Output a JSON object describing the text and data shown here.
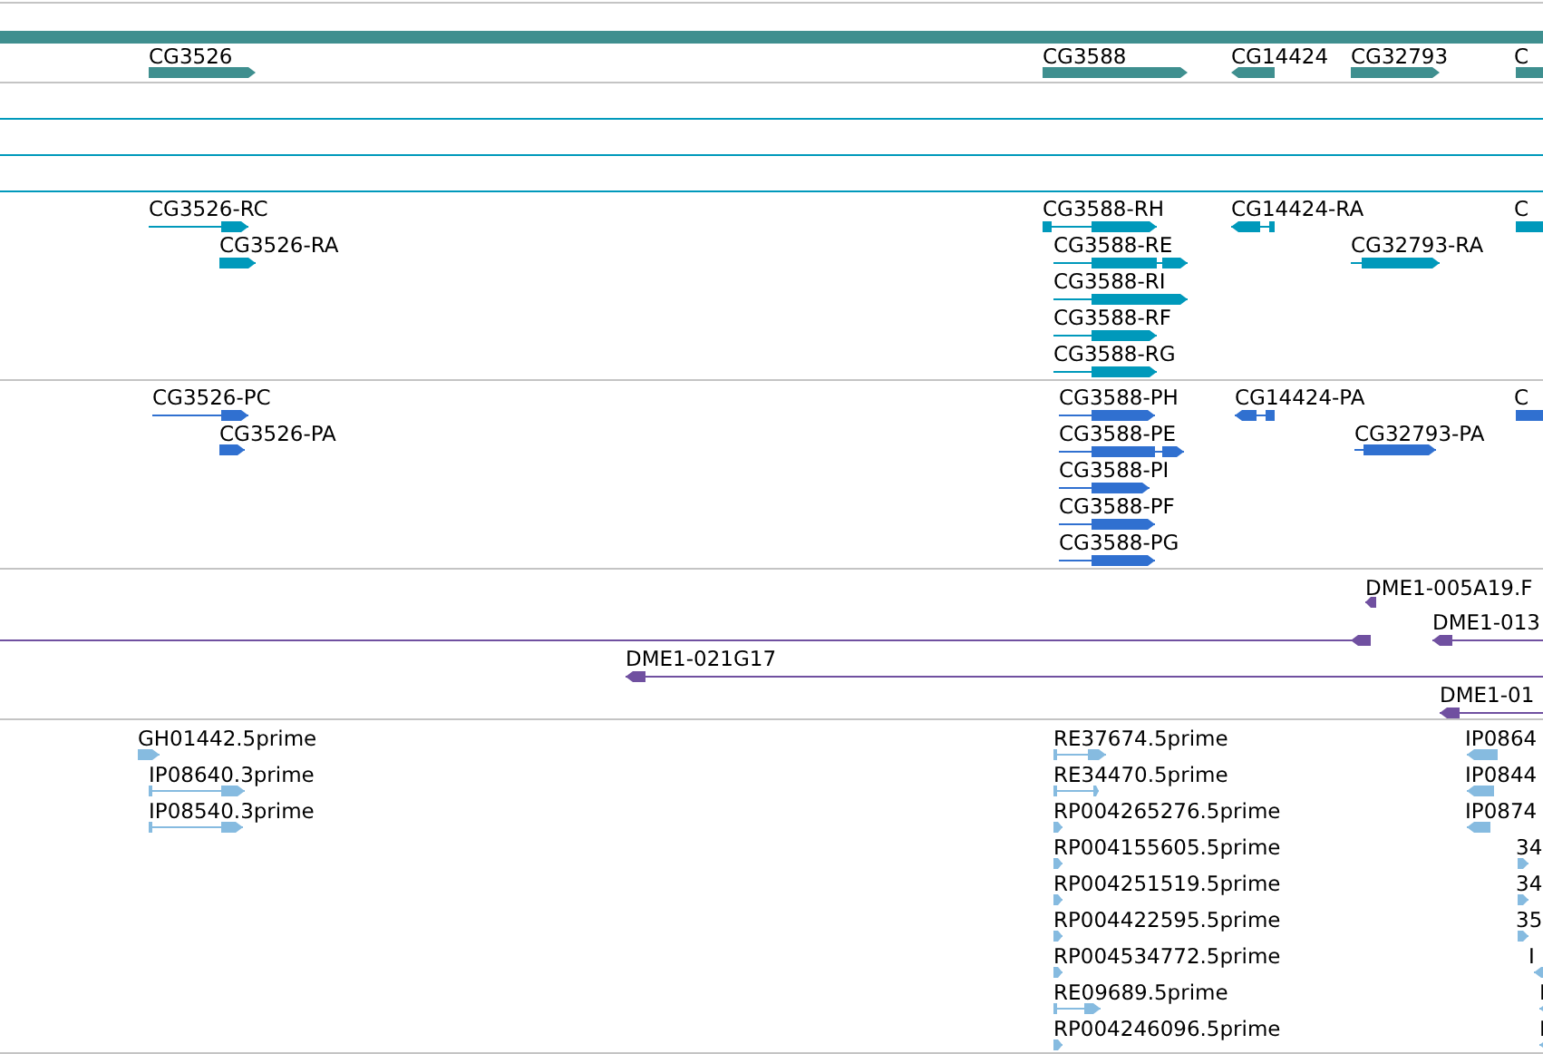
{
  "tracks": [
    {
      "kind": "gene",
      "features": [
        {
          "label": "CG3526",
          "reverse": false
        },
        {
          "label": "CG3588",
          "reverse": false
        },
        {
          "label": "CG14424",
          "reverse": true
        },
        {
          "label": "CG32793",
          "reverse": false
        },
        {
          "label": "C",
          "reverse": false
        }
      ]
    },
    {
      "kind": "transcript",
      "features": [
        {
          "label": "CG3526-RC",
          "reverse": false
        },
        {
          "label": "CG3526-RA",
          "reverse": false
        },
        {
          "label": "CG3588-RH",
          "reverse": false
        },
        {
          "label": "CG3588-RE",
          "reverse": false
        },
        {
          "label": "CG3588-RI",
          "reverse": false
        },
        {
          "label": "CG3588-RF",
          "reverse": false
        },
        {
          "label": "CG3588-RG",
          "reverse": false
        },
        {
          "label": "CG14424-RA",
          "reverse": true
        },
        {
          "label": "CG32793-RA",
          "reverse": false
        },
        {
          "label": "C",
          "reverse": false
        }
      ]
    },
    {
      "kind": "protein",
      "features": [
        {
          "label": "CG3526-PC",
          "reverse": false
        },
        {
          "label": "CG3526-PA",
          "reverse": false
        },
        {
          "label": "CG3588-PH",
          "reverse": false
        },
        {
          "label": "CG3588-PE",
          "reverse": false
        },
        {
          "label": "CG3588-PI",
          "reverse": false
        },
        {
          "label": "CG3588-PF",
          "reverse": false
        },
        {
          "label": "CG3588-PG",
          "reverse": false
        },
        {
          "label": "CG14424-PA",
          "reverse": true
        },
        {
          "label": "CG32793-PA",
          "reverse": false
        },
        {
          "label": "C",
          "reverse": false
        }
      ]
    },
    {
      "kind": "clone",
      "features": [
        {
          "label": "DME1-005A19.F",
          "reverse": true
        },
        {
          "reverse": true
        },
        {
          "label": "DME1-013",
          "reverse": true
        },
        {
          "label": "DME1-021G17",
          "reverse": true
        },
        {
          "label": "DME1-01",
          "reverse": true
        }
      ]
    },
    {
      "kind": "est",
      "features": [
        {
          "label": "GH01442.5prime",
          "reverse": false
        },
        {
          "label": "IP08640.3prime",
          "reverse": false
        },
        {
          "label": "IP08540.3prime",
          "reverse": false
        },
        {
          "label": "RE37674.5prime",
          "reverse": false
        },
        {
          "label": "RE34470.5prime",
          "reverse": false
        },
        {
          "label": "RP004265276.5prime",
          "reverse": false
        },
        {
          "label": "RP004155605.5prime",
          "reverse": false
        },
        {
          "label": "RP004251519.5prime",
          "reverse": false
        },
        {
          "label": "RP004422595.5prime",
          "reverse": false
        },
        {
          "label": "RP004534772.5prime",
          "reverse": false
        },
        {
          "label": "RE09689.5prime",
          "reverse": false
        },
        {
          "label": "RP004246096.5prime",
          "reverse": false
        },
        {
          "label": "IP0864",
          "reverse": true
        },
        {
          "label": "IP0844",
          "reverse": true
        },
        {
          "label": "IP0874",
          "reverse": true
        },
        {
          "label": "34",
          "reverse": false
        },
        {
          "label": "34",
          "reverse": false
        },
        {
          "label": "35",
          "reverse": false
        },
        {
          "label": "I",
          "reverse": true
        },
        {
          "label": "I",
          "reverse": true
        },
        {
          "label": "I",
          "reverse": true
        }
      ]
    }
  ]
}
